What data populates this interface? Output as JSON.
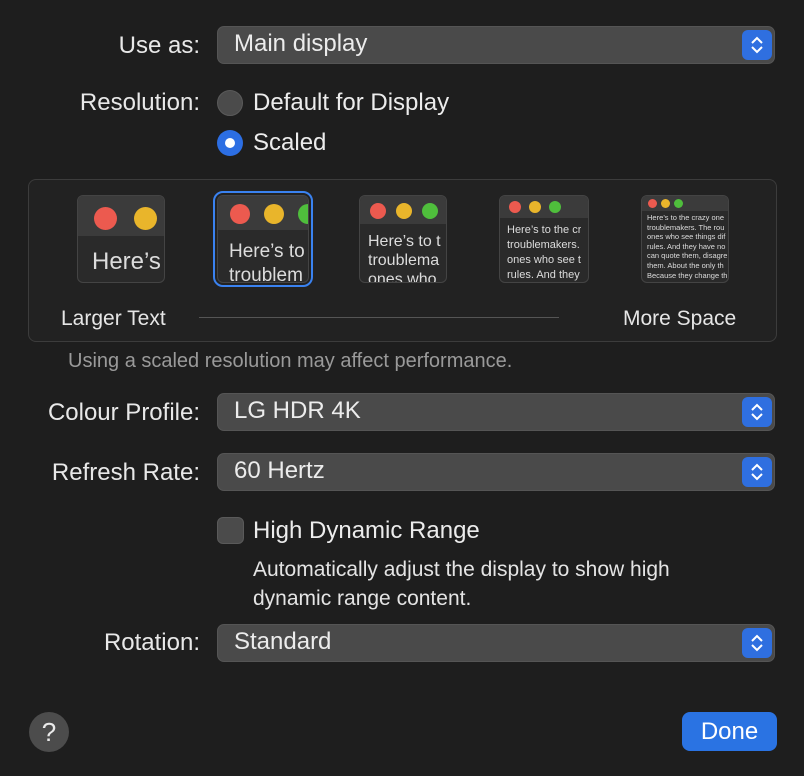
{
  "use_as": {
    "label": "Use as:",
    "value": "Main display"
  },
  "resolution": {
    "label": "Resolution:",
    "options": [
      "Default for Display",
      "Scaled"
    ],
    "selected": "Scaled"
  },
  "scale": {
    "thumb_texts": [
      "Here’s",
      "Here’s to\ntroublem",
      "Here’s to t\ntroublema\nones who",
      "Here’s to the cr\ntroublemakers.\nones who see t\nrules. And they",
      "Here’s to the crazy one\ntroublemakers. The rou\nones who see things dif\nrules. And they have no\ncan quote them, disagre\nthem. About the only th\nBecause they change th"
    ],
    "selected_index": 1,
    "left_label": "Larger Text",
    "right_label": "More Space",
    "note": "Using a scaled resolution may affect performance."
  },
  "colour_profile": {
    "label": "Colour Profile:",
    "value": "LG HDR 4K"
  },
  "refresh_rate": {
    "label": "Refresh Rate:",
    "value": "60 Hertz"
  },
  "hdr": {
    "label": "High Dynamic Range",
    "checked": false,
    "description_line1": "Automatically adjust the display to show high",
    "description_line2": "dynamic range content."
  },
  "rotation": {
    "label": "Rotation:",
    "value": "Standard"
  },
  "help_label": "?",
  "done_label": "Done",
  "colors": {
    "accent": "#2a73e3",
    "background": "#1e1e1e"
  }
}
